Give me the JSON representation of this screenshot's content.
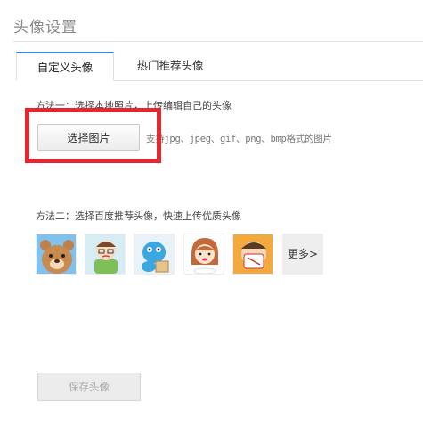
{
  "page": {
    "title": "头像设置"
  },
  "tabs": [
    {
      "label": "自定义头像",
      "active": true
    },
    {
      "label": "热门推荐头像",
      "active": false
    }
  ],
  "method1": {
    "label": "方法一：选择本地照片，上传编辑自己的头像",
    "button": "选择图片",
    "hint": "支持jpg、jpeg、gif、png、bmp格式的图片"
  },
  "method2": {
    "label": "方法二：选择百度推荐头像，快速上传优质头像",
    "avatars": [
      "bear-avatar",
      "sick-boy-avatar",
      "blue-creature-avatar",
      "girl-eating-avatar",
      "boy-mask-avatar"
    ],
    "more": "更多>"
  },
  "save_button": "保存头像",
  "colors": {
    "accent": "#3a8de6",
    "highlight_box": "#e8262e"
  }
}
